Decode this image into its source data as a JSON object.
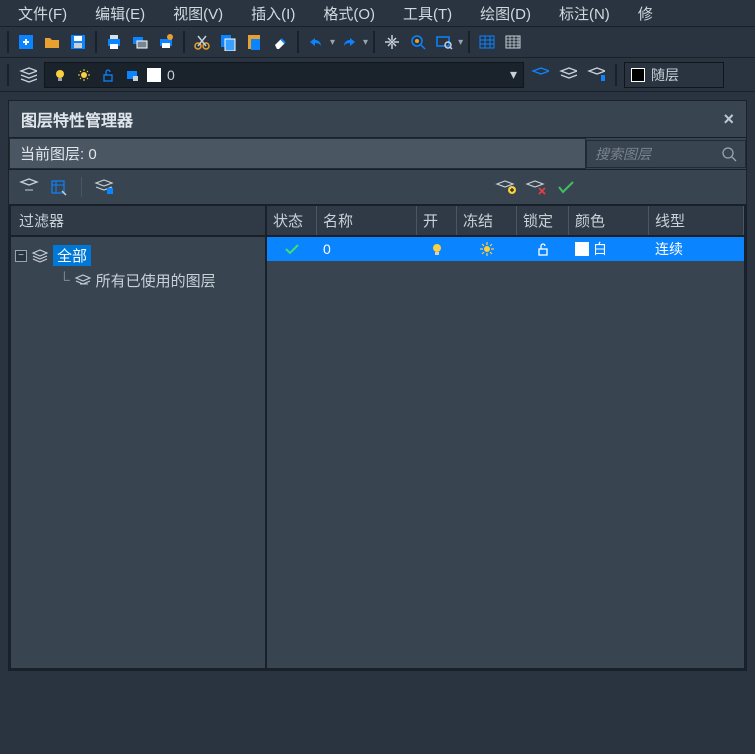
{
  "menu": {
    "file": "文件(F)",
    "edit": "编辑(E)",
    "view": "视图(V)",
    "insert": "插入(I)",
    "format": "格式(O)",
    "tools": "工具(T)",
    "draw": "绘图(D)",
    "annotate": "标注(N)",
    "modify": "修"
  },
  "layer_bar": {
    "dropdown_value": "0",
    "bylayer": "随层"
  },
  "panel": {
    "title": "图层特性管理器",
    "current_layer_label": "当前图层: 0",
    "search_placeholder": "搜索图层",
    "filter_header": "过滤器",
    "tree_all": "全部",
    "tree_used": "所有已使用的图层",
    "cols": {
      "state": "状态",
      "name": "名称",
      "on": "开",
      "freeze": "冻结",
      "lock": "锁定",
      "color": "颜色",
      "linetype": "线型"
    },
    "row": {
      "name": "0",
      "color_name": "白",
      "linetype": "连续"
    }
  }
}
